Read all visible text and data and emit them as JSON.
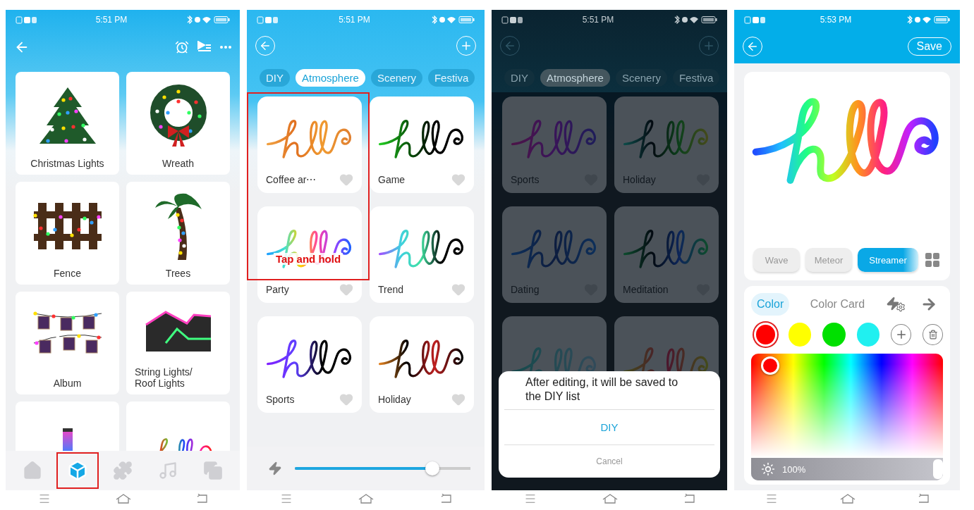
{
  "screens": [
    {
      "kind": "scenes",
      "status": {
        "time": "5:51 PM"
      },
      "scenes": [
        {
          "label": "Christmas Lights",
          "kind": "tree"
        },
        {
          "label": "Wreath",
          "kind": "wreath"
        },
        {
          "label": "Fence",
          "kind": "fence"
        },
        {
          "label": "Trees",
          "kind": "palm"
        },
        {
          "label": "Album",
          "kind": "album"
        },
        {
          "label": "String Lights/\nRoof Lights",
          "kind": "house"
        },
        {
          "kind": "tube"
        },
        {
          "kind": "hello"
        }
      ],
      "nav": [
        {
          "kind": "home",
          "selected": false,
          "highlighted": false
        },
        {
          "kind": "cube",
          "selected": true,
          "highlighted": true
        },
        {
          "kind": "puzzle",
          "selected": false,
          "highlighted": false
        },
        {
          "kind": "music",
          "selected": false,
          "highlighted": false
        },
        {
          "kind": "copy",
          "selected": false,
          "highlighted": false
        }
      ]
    },
    {
      "kind": "effects",
      "status": {
        "time": "5:51 PM"
      },
      "categories": [
        {
          "label": "DIY",
          "selected": false
        },
        {
          "label": "Atmosphere",
          "selected": true
        },
        {
          "label": "Scenery",
          "selected": false
        },
        {
          "label": "Festiva",
          "selected": false
        }
      ],
      "effects": [
        {
          "label": "Coffee ar⋯",
          "liked": false
        },
        {
          "label": "Game",
          "liked": false
        },
        {
          "label": "Party",
          "liked": false
        },
        {
          "label": "Trend",
          "liked": false
        },
        {
          "label": "Sports",
          "liked": false
        },
        {
          "label": "Holiday",
          "liked": false
        }
      ],
      "callout": {
        "text": "Tap and hold"
      },
      "speed": {
        "level": 0.81
      }
    },
    {
      "kind": "dialog",
      "status": {
        "time": "5:51 PM"
      },
      "categories": [
        {
          "label": "DIY",
          "selected": false
        },
        {
          "label": "Atmosphere",
          "selected": true
        },
        {
          "label": "Scenery",
          "selected": false
        },
        {
          "label": "Festiva",
          "selected": false
        }
      ],
      "effects": [
        {
          "kind": "full",
          "label": "Sports",
          "liked": false
        },
        {
          "kind": "full",
          "label": "Holiday",
          "liked": false
        },
        {
          "kind": "full",
          "label": "Dating",
          "liked": false
        },
        {
          "kind": "full",
          "label": "Meditation",
          "liked": false
        },
        {
          "kind": "partial"
        },
        {
          "kind": "partial"
        }
      ],
      "dialog": {
        "message": "After editing, it will be saved to the DIY list",
        "confirm": "DIY",
        "cancel": "Cancel"
      }
    },
    {
      "kind": "editor",
      "status": {
        "time": "5:53 PM"
      },
      "save": "Save",
      "modes": [
        {
          "label": "Wave",
          "selected": false
        },
        {
          "label": "Meteor",
          "selected": false
        },
        {
          "label": "Streamer",
          "selected": true
        }
      ],
      "tabs": [
        {
          "kind": "text",
          "label": "Color",
          "selected": true
        },
        {
          "kind": "text",
          "label": "Color Card",
          "selected": false
        },
        {
          "kind": "bolt-gear",
          "selected": false
        },
        {
          "kind": "arrow",
          "selected": false
        }
      ],
      "swatches": [
        {
          "color": "#ff0000",
          "selected": true
        },
        {
          "color": "#ffff00",
          "selected": false
        },
        {
          "color": "#00e000",
          "selected": false
        },
        {
          "color": "#20f0f0",
          "selected": false
        }
      ],
      "brightness": {
        "level": 1,
        "reading": "100%"
      }
    }
  ]
}
